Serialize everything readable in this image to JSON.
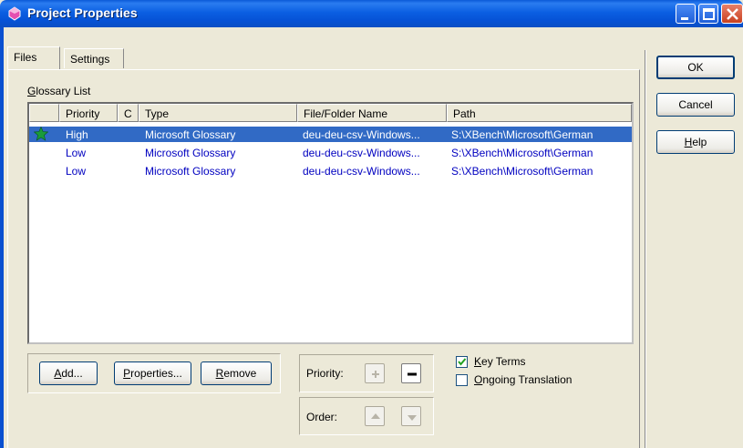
{
  "window": {
    "title": "Project Properties"
  },
  "tabs": [
    {
      "label": "Files"
    },
    {
      "label": "Settings"
    }
  ],
  "glossary": {
    "label_prefix": "G",
    "label_rest": "lossary List",
    "columns": [
      "",
      "Priority",
      "C",
      "Type",
      "File/Folder Name",
      "Path"
    ],
    "rows": [
      {
        "starred": true,
        "priority": "High",
        "c": "",
        "type": "Microsoft Glossary",
        "file": "deu-deu-csv-Windows...",
        "path": "S:\\XBench\\Microsoft\\German"
      },
      {
        "starred": false,
        "priority": "Low",
        "c": "",
        "type": "Microsoft Glossary",
        "file": "deu-deu-csv-Windows...",
        "path": "S:\\XBench\\Microsoft\\German"
      },
      {
        "starred": false,
        "priority": "Low",
        "c": "",
        "type": "Microsoft Glossary",
        "file": "deu-deu-csv-Windows...",
        "path": "S:\\XBench\\Microsoft\\German"
      }
    ]
  },
  "buttons": {
    "add": {
      "accel": "A",
      "rest": "dd..."
    },
    "properties": {
      "accel": "P",
      "rest": "roperties..."
    },
    "remove": {
      "accel": "R",
      "rest": "emove"
    },
    "ok": {
      "label": "OK"
    },
    "cancel": {
      "label": "Cancel"
    },
    "help": {
      "accel": "H",
      "rest": "elp"
    }
  },
  "priority": {
    "label": "Priority:"
  },
  "order": {
    "label": "Order:"
  },
  "options": {
    "key_terms": {
      "accel": "K",
      "rest": "ey Terms",
      "checked": true
    },
    "ongoing_translation": {
      "accel": "O",
      "rest": "ngoing Translation",
      "checked": false
    }
  },
  "colors": {
    "titlebar": "#0a5ad8",
    "selection": "#316ac5",
    "row_text": "#0000c0",
    "dialog_bg": "#ece9d8"
  },
  "icons": {
    "app": "gem-icon",
    "star": "star-icon",
    "priority_up": "plus-icon",
    "priority_down": "minus-icon",
    "order_up": "arrow-up-icon",
    "order_down": "arrow-down-icon"
  }
}
